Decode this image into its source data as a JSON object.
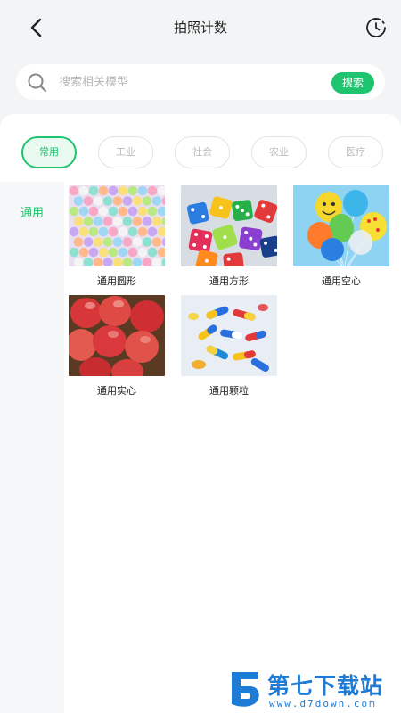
{
  "header": {
    "title": "拍照计数"
  },
  "search": {
    "placeholder": "搜索相关模型",
    "button_label": "搜索"
  },
  "tabs": [
    {
      "label": "常用",
      "active": true
    },
    {
      "label": "工业",
      "active": false
    },
    {
      "label": "社会",
      "active": false
    },
    {
      "label": "农业",
      "active": false
    },
    {
      "label": "医疗",
      "active": false
    }
  ],
  "sidebar": {
    "items": [
      {
        "label": "通用",
        "active": true
      }
    ]
  },
  "models": [
    {
      "label": "通用圆形",
      "image": "colorful-beads"
    },
    {
      "label": "通用方形",
      "image": "colorful-dice"
    },
    {
      "label": "通用空心",
      "image": "balloons"
    },
    {
      "label": "通用实心",
      "image": "red-apples"
    },
    {
      "label": "通用颗粒",
      "image": "capsule-pills"
    }
  ],
  "watermark": {
    "brand": "第七下载站",
    "url": "www.d7down.com"
  },
  "colors": {
    "accent": "#1ec46e",
    "watermark": "#1e7bd6"
  }
}
